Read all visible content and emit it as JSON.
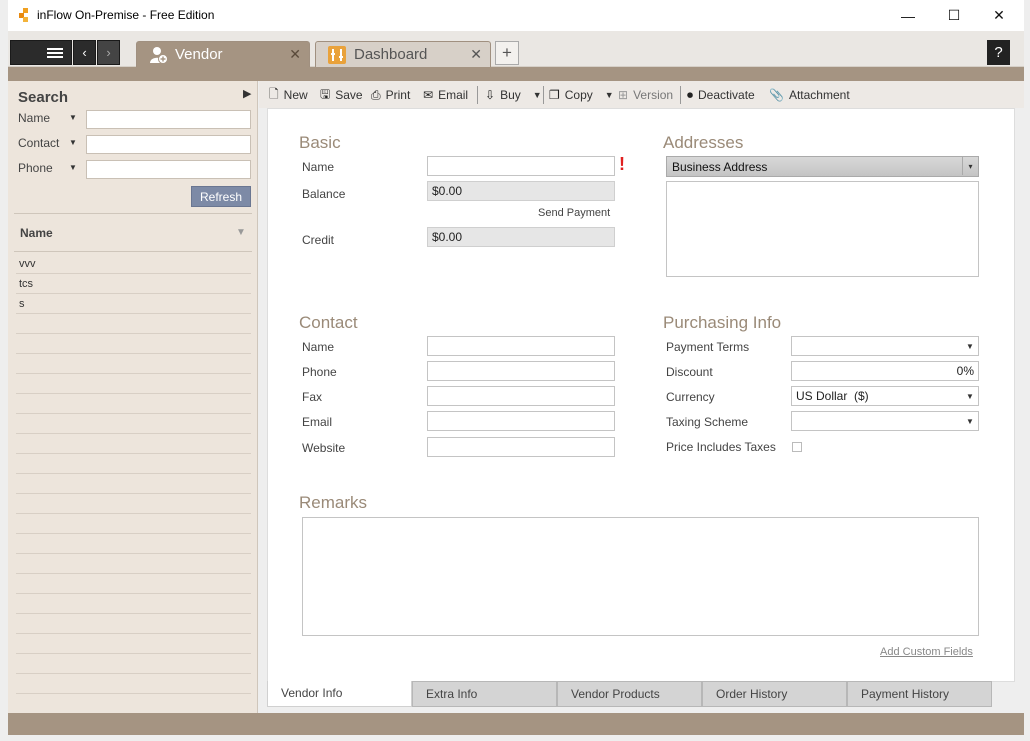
{
  "window": {
    "title": "inFlow On-Premise - Free Edition",
    "minimize": "—",
    "maximize": "☐",
    "close": "✕"
  },
  "tabs": [
    {
      "label": "Vendor",
      "active": true
    },
    {
      "label": "Dashboard",
      "active": false
    }
  ],
  "tabstrip": {
    "add": "+",
    "help": "?",
    "close": "✕"
  },
  "search": {
    "title": "Search",
    "fields": [
      {
        "label": "Name",
        "value": ""
      },
      {
        "label": "Contact",
        "value": ""
      },
      {
        "label": "Phone",
        "value": ""
      }
    ],
    "refresh": "Refresh",
    "column_header": "Name",
    "results": [
      "vvv",
      "tcs",
      "s"
    ]
  },
  "toolbar": {
    "new": "New",
    "save": "Save",
    "print": "Print",
    "email": "Email",
    "buy": "Buy",
    "copy": "Copy",
    "version": "Version",
    "deactivate": "Deactivate",
    "attachment": "Attachment"
  },
  "basic": {
    "title": "Basic",
    "name_label": "Name",
    "name_value": "",
    "required_mark": "!",
    "balance_label": "Balance",
    "balance_value": "$0.00",
    "send_payment": "Send Payment",
    "credit_label": "Credit",
    "credit_value": "$0.00"
  },
  "addresses": {
    "title": "Addresses",
    "type": "Business Address",
    "value": ""
  },
  "contact": {
    "title": "Contact",
    "fields": [
      {
        "label": "Name",
        "value": ""
      },
      {
        "label": "Phone",
        "value": ""
      },
      {
        "label": "Fax",
        "value": ""
      },
      {
        "label": "Email",
        "value": ""
      },
      {
        "label": "Website",
        "value": ""
      }
    ]
  },
  "purchasing": {
    "title": "Purchasing Info",
    "payment_terms_label": "Payment Terms",
    "payment_terms_value": "",
    "discount_label": "Discount",
    "discount_value": "0%",
    "currency_label": "Currency",
    "currency_value": "US Dollar  ($)",
    "taxing_label": "Taxing Scheme",
    "taxing_value": "",
    "price_includes_taxes_label": "Price Includes Taxes",
    "price_includes_taxes": false
  },
  "remarks": {
    "title": "Remarks",
    "value": ""
  },
  "add_custom_fields": "Add Custom Fields",
  "bottom_tabs": [
    {
      "label": "Vendor Info",
      "active": true
    },
    {
      "label": "Extra Info",
      "active": false
    },
    {
      "label": "Vendor Products",
      "active": false
    },
    {
      "label": "Order History",
      "active": false
    },
    {
      "label": "Payment History",
      "active": false
    }
  ],
  "colors": {
    "accent_brown": "#a59482",
    "panel_bg": "#ede5dc",
    "section_title": "#9a8a78",
    "refresh_button": "#7d8aa6",
    "required": "#e02020"
  }
}
